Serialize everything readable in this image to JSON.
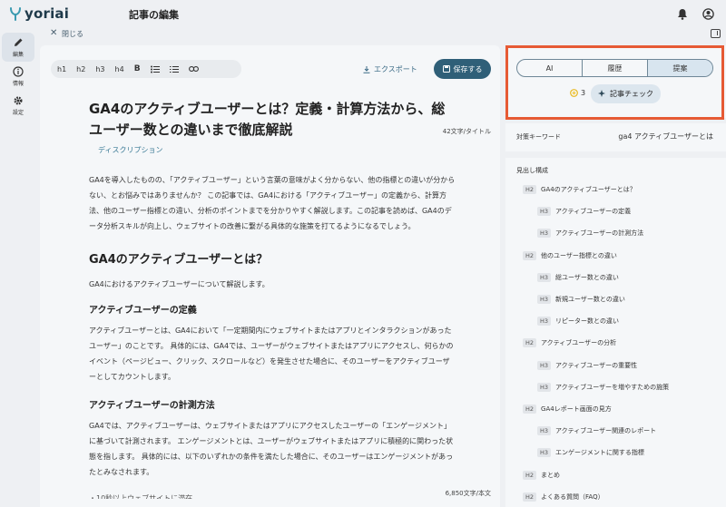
{
  "header": {
    "logo": "yoriai",
    "page_title": "記事の編集"
  },
  "subbar": {
    "close_label": "閉じる"
  },
  "rail": [
    {
      "label": "編集",
      "icon": "pencil-icon"
    },
    {
      "label": "情報",
      "icon": "info-icon"
    },
    {
      "label": "設定",
      "icon": "gear-icon"
    }
  ],
  "toolbar": {
    "formats": [
      "h1",
      "h2",
      "h3",
      "h4",
      "B"
    ],
    "export_label": "エクスポート",
    "save_label": "保存する"
  },
  "article": {
    "title": "GA4のアクティブユーザーとは？定義・計算方法から、総ユーザー数との違いまで徹底解説",
    "title_count": "42文字/タイトル",
    "description_tag": "ディスクリプション",
    "intro": "GA4を導入したものの、「アクティブユーザー」という言葉の意味がよく分からない、他の指標との違いが分からない、とお悩みではありませんか？ この記事では、GA4における「アクティブユーザー」の定義から、計算方法、他のユーザー指標との違い、分析のポイントまでを分かりやすく解説します。この記事を読めば、GA4のデータ分析スキルが向上し、ウェブサイトの改善に繋がる具体的な施策を打てるようになるでしょう。",
    "h2_1": "GA4のアクティブユーザーとは？",
    "p_1": "GA4におけるアクティブユーザーについて解説します。",
    "h3_1": "アクティブユーザーの定義",
    "p_2": "アクティブユーザーとは、GA4において「一定期間内にウェブサイトまたはアプリとインタラクションがあったユーザー」のことです。 具体的には、GA4では、ユーザーがウェブサイトまたはアプリにアクセスし、何らかのイベント（ページビュー、クリック、スクロールなど）を発生させた場合に、そのユーザーをアクティブユーザーとしてカウントします。",
    "h3_2": "アクティブユーザーの計測方法",
    "p_3": "GA4では、アクティブユーザーは、ウェブサイトまたはアプリにアクセスしたユーザーの「エンゲージメント」に基づいて計測されます。 エンゲージメントとは、ユーザーがウェブサイトまたはアプリに積極的に関わった状態を指します。 具体的には、以下のいずれかの条件を満たした場合に、そのユーザーはエンゲージメントがあったとみなされます。",
    "list_cut": "・10秒以上ウェブサイトに滞在",
    "body_count": "6,850文字/本文"
  },
  "right_panel": {
    "tabs": [
      "AI",
      "履歴",
      "提案"
    ],
    "selected_tab": "提案",
    "coins": "3",
    "check_label": "記事チェック",
    "keyword_label": "対策キーワード",
    "keyword_value": "ga4 アクティブユーザーとは",
    "outline_title": "見出し構成",
    "outline": [
      {
        "level": "H2",
        "text": "GA4のアクティブユーザーとは？"
      },
      {
        "level": "H3",
        "text": "アクティブユーザーの定義"
      },
      {
        "level": "H3",
        "text": "アクティブユーザーの計測方法"
      },
      {
        "level": "H2",
        "text": "他のユーザー指標との違い"
      },
      {
        "level": "H3",
        "text": "総ユーザー数との違い"
      },
      {
        "level": "H3",
        "text": "新規ユーザー数との違い"
      },
      {
        "level": "H3",
        "text": "リピーター数との違い"
      },
      {
        "level": "H2",
        "text": "アクティブユーザーの分析"
      },
      {
        "level": "H3",
        "text": "アクティブユーザーの重要性"
      },
      {
        "level": "H3",
        "text": "アクティブユーザーを増やすための施策"
      },
      {
        "level": "H2",
        "text": "GA4レポート画面の見方"
      },
      {
        "level": "H3",
        "text": "アクティブユーザー関連のレポート"
      },
      {
        "level": "H3",
        "text": "エンゲージメントに関する指標"
      },
      {
        "level": "H2",
        "text": "まとめ"
      },
      {
        "level": "H2",
        "text": "よくある質問（FAQ）"
      }
    ]
  },
  "colors": {
    "accent": "#2f5f78",
    "highlight": "#e65a34",
    "tag": "#3a7a95"
  }
}
